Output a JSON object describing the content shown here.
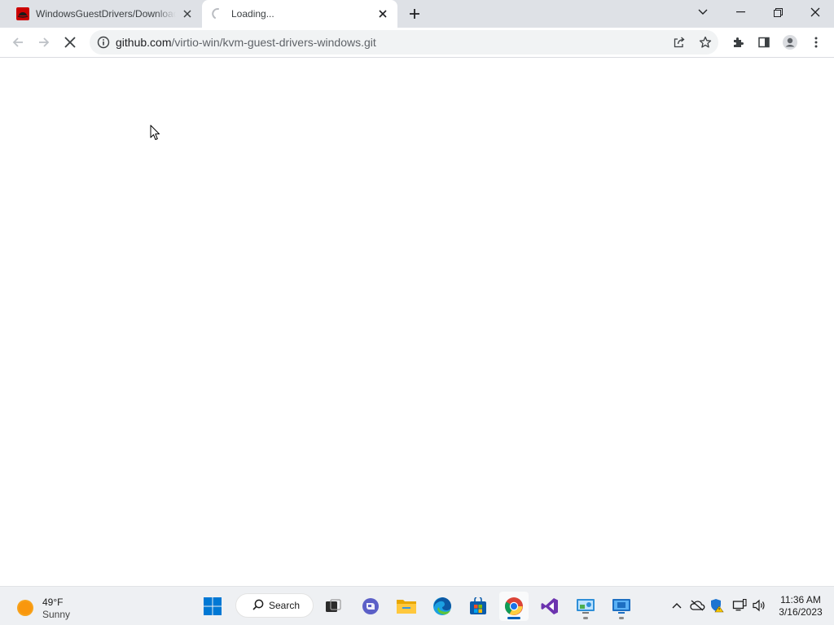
{
  "browser": {
    "tabs": [
      {
        "title": "WindowsGuestDrivers/Download",
        "favicon": "redhat-icon",
        "active": false
      },
      {
        "title": "Loading...",
        "favicon": "loading-spinner-icon",
        "active": true
      }
    ],
    "url_host": "github.com",
    "url_path": "/virtio-win/kvm-guest-drivers-windows.git",
    "page_state": "loading"
  },
  "taskbar": {
    "weather": {
      "temperature": "49°F",
      "condition": "Sunny"
    },
    "search_label": "Search",
    "apps": [
      "windows-start",
      "search",
      "task-view",
      "teams-chat",
      "file-explorer",
      "edge",
      "microsoft-store",
      "chrome",
      "visual-studio",
      "control-panel",
      "remote-desktop"
    ],
    "clock": {
      "time": "11:36 AM",
      "date": "3/16/2023"
    }
  },
  "colors": {
    "tabstrip": "#dee1e6",
    "omnibox": "#f1f3f4",
    "taskbar": "#eef0f3",
    "accent": "#005fb8"
  }
}
